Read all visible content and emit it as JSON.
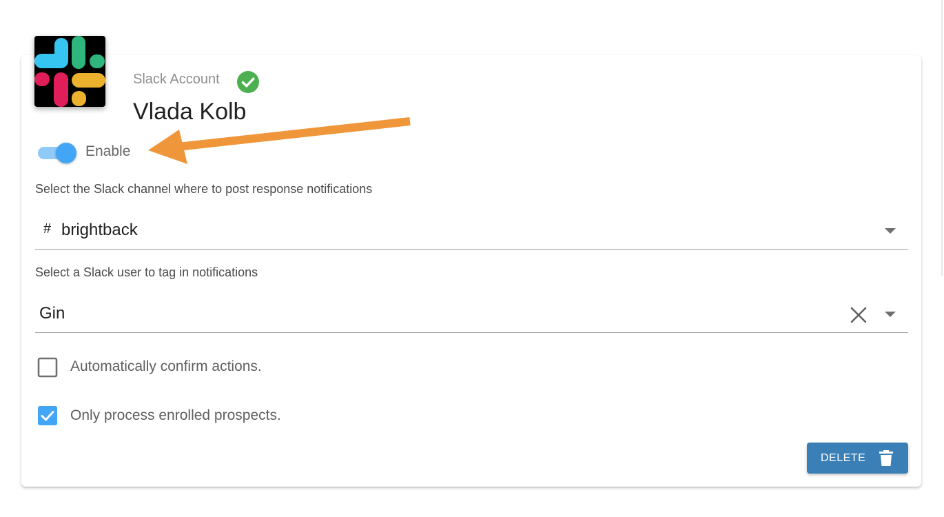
{
  "account": {
    "label": "Slack Account",
    "name": "Vlada Kolb",
    "verified": true,
    "logo_icon": "slack-logo-icon",
    "verified_icon": "check-circle-icon"
  },
  "toggle": {
    "label": "Enable",
    "enabled": true
  },
  "channel_select": {
    "label": "Select the Slack channel where to post response notifications",
    "prefix": "#",
    "value": "brightback",
    "icon": "chevron-down-icon"
  },
  "user_select": {
    "label": "Select a Slack user to tag in notifications",
    "value": "Gin",
    "clear_icon": "close-icon",
    "icon": "chevron-down-icon"
  },
  "options": [
    {
      "label": "Automatically confirm actions.",
      "checked": false
    },
    {
      "label": "Only process enrolled prospects.",
      "checked": true
    }
  ],
  "delete_button": {
    "label": "DELETE",
    "icon": "trash-icon"
  },
  "colors": {
    "accent": "#42a5f5",
    "accent_light": "#90caf9",
    "button": "#3a7fb5",
    "verified_green": "#4caf50",
    "annotation_arrow": "#f0963a",
    "slack_blue": "#36c5f0",
    "slack_green": "#2eb67d",
    "slack_red": "#e01e5a",
    "slack_yellow": "#ecb22e"
  }
}
